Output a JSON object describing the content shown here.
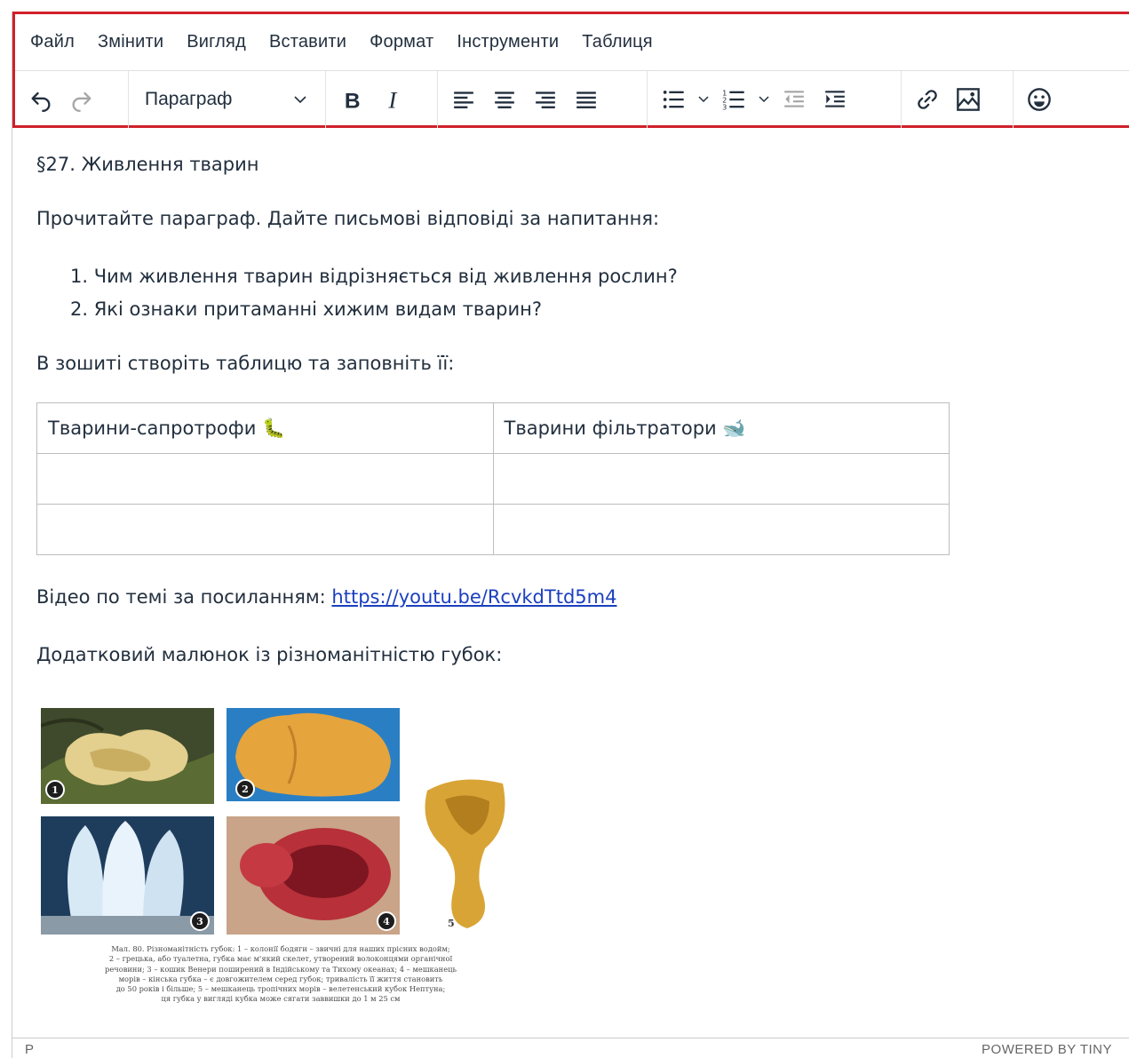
{
  "menubar": {
    "items": [
      "Файл",
      "Змінити",
      "Вигляд",
      "Вставити",
      "Формат",
      "Інструменти",
      "Таблиця"
    ]
  },
  "toolbar": {
    "block_format": "Параграф",
    "icons": [
      "undo-icon",
      "redo-icon",
      "bold-icon",
      "italic-icon",
      "align-left-icon",
      "align-center-icon",
      "align-right-icon",
      "justify-icon",
      "bullet-list-icon",
      "numbered-list-icon",
      "outdent-icon",
      "indent-icon",
      "link-icon",
      "image-icon",
      "emoji-icon"
    ]
  },
  "content": {
    "heading": "§27. Живлення тварин",
    "intro": "Прочитайте параграф. Дайте письмові відповіді за напитання:",
    "questions": [
      "1. Чим живлення тварин відрізняється від живлення рослин?",
      "2. Які ознаки притаманні хижим видам тварин?"
    ],
    "table_note": "В зошиті створіть таблицю та заповніть її:",
    "table": {
      "headers": [
        "Тварини-сапротрофи 🐛",
        "Тварини фільтратори 🐋"
      ],
      "rows": [
        [
          "",
          ""
        ],
        [
          "",
          ""
        ]
      ]
    },
    "video_label": "Відео по темі за посиланням: ",
    "video_link": "https://youtu.be/RcvkdTtd5m4",
    "extra_label": "Додатковий малюнок із різноманітністю губок:",
    "figure": {
      "badges": [
        "1",
        "2",
        "3",
        "4",
        "5"
      ],
      "caption_lines": [
        "Мал. 80. Різноманітність губок: 1 – колонії бодяги – звичні для наших прісних водойм;",
        "2 – грецька, або туалетна, губка має м'який скелет, утворений волоконцями органічної",
        "речовини; 3 – кошик Венери поширений в Індійському та Тихому океанах; 4 – мешканець",
        "морів – кінська губка – є довгожителем серед губок; тривалість її життя становить",
        "до 50 років і більше; 5 – мешканець тропічних морів – велетенський кубок Нептуна;",
        "ця губка у вигляді кубка може сягати заввишки до 1 м 25 см"
      ]
    }
  },
  "statusbar": {
    "path": "P",
    "powered": "POWERED BY TINY"
  },
  "colors": {
    "toolbar_highlight": "#d0202a",
    "link": "#1a3fbf",
    "text": "#222f3e"
  }
}
